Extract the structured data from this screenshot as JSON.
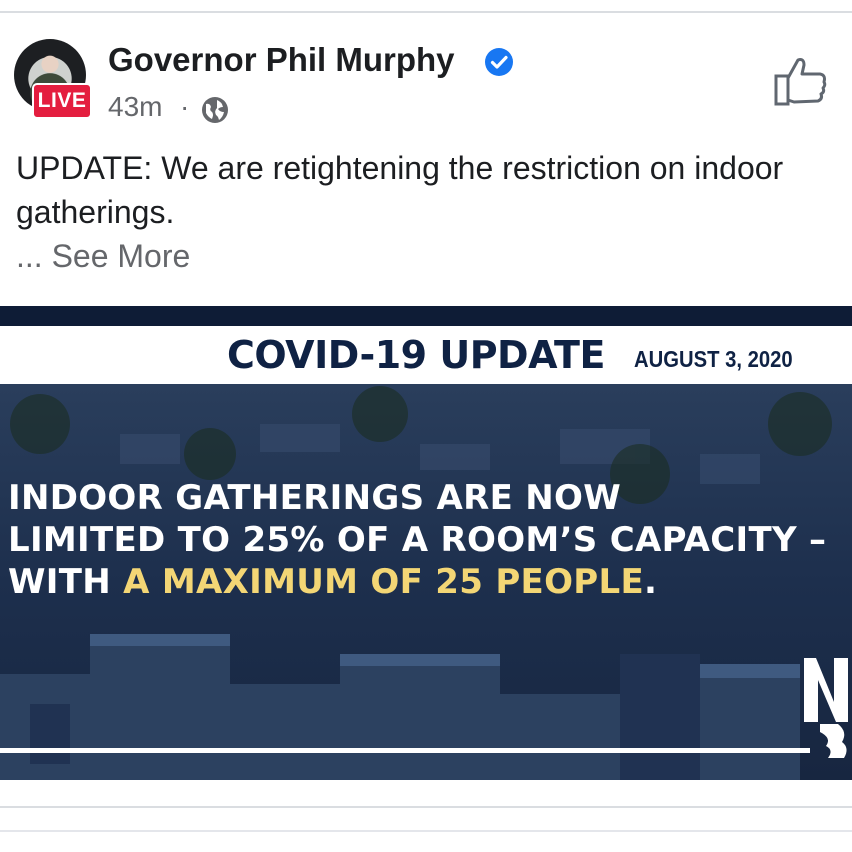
{
  "post": {
    "author": "Governor Phil Murphy",
    "live_badge": "LIVE",
    "time": "43m",
    "time_separator": "·",
    "text": "UPDATE: We are retightening the restriction on indoor gatherings.",
    "see_more": "... See More"
  },
  "image": {
    "banner_title": "COVID-19 UPDATE",
    "banner_date": "AUGUST 3, 2020",
    "headline_line1": "INDOOR GATHERINGS ARE NOW",
    "headline_line2": "LIMITED TO 25% OF A ROOM’S CAPACITY –",
    "headline_line3_prefix": "WITH ",
    "headline_line3_highlight": "A MAXIMUM OF 25 PEOPLE",
    "headline_line3_suffix": ".",
    "logo_text": "NJ"
  },
  "colors": {
    "live_red": "#e41e3f",
    "verified_blue": "#1877f2",
    "navy": "#0f2244",
    "highlight_yellow": "#f3d675"
  },
  "icons": {
    "verified": "verified-badge-icon",
    "audience": "globe-icon",
    "like": "thumbs-up-icon"
  }
}
